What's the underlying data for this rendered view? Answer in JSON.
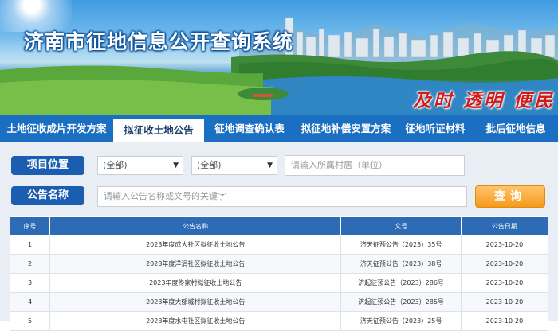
{
  "site_title": "济南市征地信息公开查询系统",
  "slogan": "及时 透明 便民",
  "nav": [
    {
      "label": "土地征收成片开发方案"
    },
    {
      "label": "拟征收土地公告"
    },
    {
      "label": "征地调查确认表"
    },
    {
      "label": "拟征地补偿安置方案"
    },
    {
      "label": "征地听证材料"
    },
    {
      "label": "批后征地信息"
    }
  ],
  "search": {
    "location_label": "项目位置",
    "select1": "(全部)",
    "select2": "(全部)",
    "village_placeholder": "请输入所属村居（单位）",
    "name_label": "公告名称",
    "name_placeholder": "请输入公告名称或文号的关键字",
    "query_label": "查询"
  },
  "table": {
    "headers": [
      "序号",
      "公告名称",
      "文号",
      "公告日期"
    ],
    "rows": [
      [
        "1",
        "2023年度成大社区拟征收土地公告",
        "济天征预公告（2023）35号",
        "2023-10-20"
      ],
      [
        "2",
        "2023年度洋涓社区拟征收土地公告",
        "济天征预公告（2023）38号",
        "2023-10-20"
      ],
      [
        "3",
        "2023年度佟家村拟征收土地公告",
        "济起征预公告（2023）286号",
        "2023-10-20"
      ],
      [
        "4",
        "2023年度大郁城村拟征收土地公告",
        "济起征预公告（2023）285号",
        "2023-10-20"
      ],
      [
        "5",
        "2023年度水屯社区拟征收土地公告",
        "济天征预公告（2023）25号",
        "2023-10-20"
      ]
    ]
  },
  "colors": {
    "nav_bg": "#1b6fc2",
    "label_bg": "#1b5db0",
    "panel_bg": "#e9eef5",
    "header_bg": "#2e6bb5",
    "button": "#f59b1c",
    "slogan": "#d11a1a"
  }
}
